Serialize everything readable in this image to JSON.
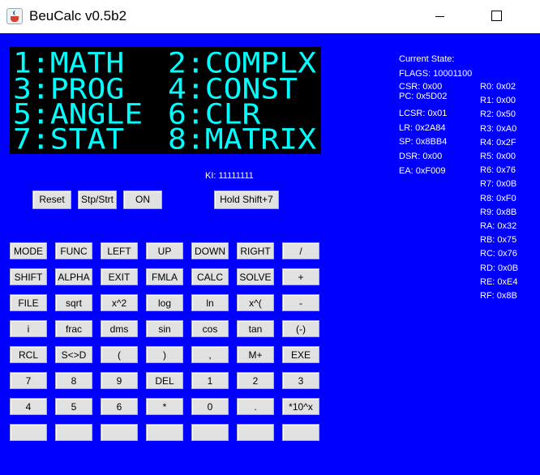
{
  "window": {
    "title": "BeuCalc v0.5b2"
  },
  "lcd": {
    "lines": [
      {
        "left": "1:MATH",
        "right": "2:COMPLX"
      },
      {
        "left": "3:PROG",
        "right": "4:CONST"
      },
      {
        "left": "5:ANGLE",
        "right": "6:CLR"
      },
      {
        "left": "7:STAT",
        "right": "8:MATRIX"
      }
    ]
  },
  "state": {
    "header": "Current State:",
    "flags": "FLAGS: 10001100",
    "csr": "CSR: 0x00",
    "pc": "PC: 0x5D02",
    "lcsr": "LCSR: 0x01",
    "lr": "LR: 0x2A84",
    "sp": "SP: 0x8BB4",
    "dsr": "DSR: 0x00",
    "ea": "EA: 0xF009",
    "registers": [
      "R0: 0x02",
      "R1: 0x00",
      "R2: 0x50",
      "R3: 0xA0",
      "R4: 0x2F",
      "R5: 0x00",
      "R6: 0x76",
      "R7: 0x0B",
      "R8: 0xF0",
      "R9: 0x8B",
      "RA: 0x32",
      "RB: 0x75",
      "RC: 0x76",
      "RD: 0x0B",
      "RE: 0xE4",
      "RF: 0x8B"
    ]
  },
  "ki": "KI: 11111111",
  "controls": {
    "reset": "Reset",
    "stpstrt": "Stp/Strt",
    "on": "ON",
    "hold": "Hold Shift+7"
  },
  "keypad": [
    [
      "MODE",
      "FUNC",
      "LEFT",
      "UP",
      "DOWN",
      "RIGHT",
      "/"
    ],
    [
      "SHIFT",
      "ALPHA",
      "EXIT",
      "FMLA",
      "CALC",
      "SOLVE",
      "+"
    ],
    [
      "FILE",
      "sqrt",
      "x^2",
      "log",
      "ln",
      "x^(",
      "-"
    ],
    [
      "i",
      "frac",
      "dms",
      "sin",
      "cos",
      "tan",
      "(-)"
    ],
    [
      "RCL",
      "S<>D",
      "(",
      ")",
      ",",
      "M+",
      "EXE"
    ],
    [
      "7",
      "8",
      "9",
      "DEL",
      "1",
      "2",
      "3"
    ],
    [
      "4",
      "5",
      "6",
      "*",
      "0",
      ".",
      "*10^x"
    ],
    [
      "",
      "",
      "",
      "",
      "",
      "",
      ""
    ]
  ],
  "colors": {
    "background": "#0000ff",
    "lcd_bg": "#000000",
    "lcd_text": "#00ffff",
    "button": "#e1e1e1"
  }
}
